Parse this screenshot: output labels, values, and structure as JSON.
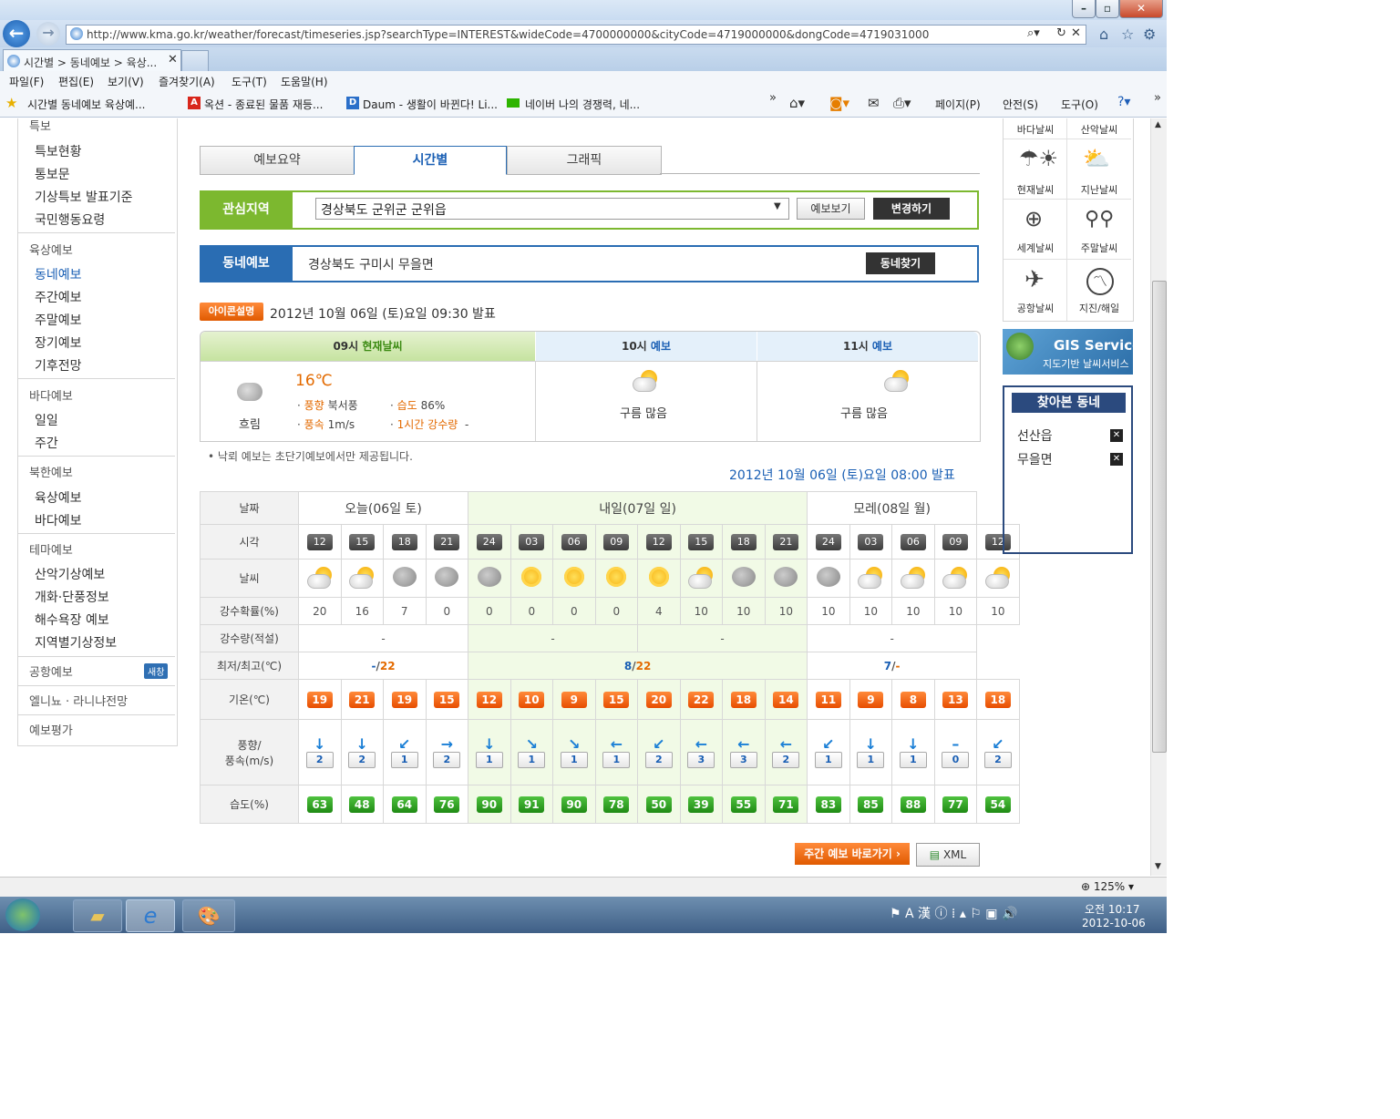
{
  "browser": {
    "url": "http://www.kma.go.kr/weather/forecast/timeseries.jsp?searchType=INTEREST&wideCode=4700000000&cityCode=4719000000&dongCode=4719031000",
    "tab_title": "시간별 > 동네예보 > 육상...",
    "menu": [
      "파일(F)",
      "편집(E)",
      "보기(V)",
      "즐겨찾기(A)",
      "도구(T)",
      "도움말(H)"
    ],
    "favorites": [
      "시간별 동네예보 육상예...",
      "옥션 - 종료된 물품 재등...",
      "Daum - 생활이 바뀐다! Li...",
      "네이버 나의 경쟁력, 네..."
    ],
    "cmd": [
      "페이지(P)",
      "안전(S)",
      "도구(O)"
    ],
    "zoom": "125%"
  },
  "taskbar": {
    "time": "오전 10:17",
    "date": "2012-10-06"
  },
  "left_nav": {
    "top_partial": "특보",
    "group1": [
      "특보현황",
      "통보문",
      "기상특보 발표기준",
      "국민행동요령"
    ],
    "sec_land": "육상예보",
    "group2": [
      "동네예보",
      "주간예보",
      "주말예보",
      "장기예보",
      "기후전망"
    ],
    "sec_sea": "바다예보",
    "group3": [
      "일일",
      "주간"
    ],
    "sec_nk": "북한예보",
    "group4": [
      "육상예보",
      "바다예보"
    ],
    "sec_theme": "테마예보",
    "group5": [
      "산악기상예보",
      "개화·단풍정보",
      "해수욕장 예보",
      "지역별기상정보"
    ],
    "sec_airport": "공항예보",
    "new_window": "새창",
    "sec_elnino": "엘니뇨 · 라니냐전망",
    "sec_eval": "예보평가"
  },
  "tabs": [
    "예보요약",
    "시간별",
    "그래픽"
  ],
  "interest": {
    "label": "관심지역",
    "selected": "경상북도 군위군 군위읍",
    "view_btn": "예보보기",
    "change_btn": "변경하기"
  },
  "dong": {
    "label": "동네예보",
    "location": "경상북도 구미시 무을면",
    "find_btn": "동네찾기"
  },
  "icon_btn": "아이콘설명",
  "issued1": "2012년 10월 06일 (토)요일 09:30 발표",
  "now": {
    "h1": "09시",
    "h1b": "현재날씨",
    "h2": "10시",
    "h2b": "예보",
    "h3": "11시",
    "h3b": "예보",
    "temp": "16℃",
    "cond": "흐림",
    "wind_dir_label": "풍향",
    "wind_dir": "북서풍",
    "hum_label": "습도",
    "hum": "86%",
    "wind_speed_label": "풍속",
    "wind_speed": "1m/s",
    "rain_label": "1시간 강수량",
    "rain": "-",
    "h2_cond": "구름 많음",
    "h3_cond": "구름 많음"
  },
  "note": "낙뢰 예보는 초단기예보에서만 제공됩니다.",
  "issued2": "2012년 10월 06일 (토)요일 08:00 발표",
  "table": {
    "row_labels": [
      "날짜",
      "시각",
      "날씨",
      "강수확률(%)",
      "강수량(적설)",
      "최저/최고(℃)",
      "기온(℃)",
      "풍향/",
      "풍속(m/s)",
      "습도(%)"
    ],
    "days": [
      "오늘(06일 토)",
      "내일(07일 일)",
      "모레(08일 월)"
    ],
    "hours": [
      "12",
      "15",
      "18",
      "21",
      "24",
      "03",
      "06",
      "09",
      "12",
      "15",
      "18",
      "21",
      "24",
      "03",
      "06",
      "09",
      "12"
    ],
    "weather": [
      "pcloud",
      "pcloud",
      "darkc",
      "darkc",
      "darkc",
      "sun",
      "sun",
      "sun",
      "sun",
      "pcloud",
      "darkc",
      "darkc",
      "darkc",
      "pcloud",
      "pcloud",
      "pcloud",
      "pcloud"
    ],
    "pop": [
      "20",
      "16",
      "7",
      "0",
      "0",
      "0",
      "0",
      "0",
      "4",
      "10",
      "10",
      "10",
      "10",
      "10",
      "10",
      "10",
      "10"
    ],
    "rain": [
      "-",
      "-",
      "-",
      "-"
    ],
    "minmax": [
      {
        "min": "-",
        "max": "22"
      },
      {
        "min": "8",
        "max": "22"
      },
      {
        "min": "7",
        "max": "-"
      }
    ],
    "temp": [
      "19",
      "21",
      "19",
      "15",
      "12",
      "10",
      "9",
      "15",
      "20",
      "22",
      "18",
      "14",
      "11",
      "9",
      "8",
      "13",
      "18"
    ],
    "wind_arrow": [
      "↓",
      "↓",
      "↙",
      "→",
      "↓",
      "↘",
      "↘",
      "←",
      "↙",
      "←",
      "←",
      "←",
      "↙",
      "↓",
      "↓",
      "–",
      "↙"
    ],
    "wind_speed": [
      "2",
      "2",
      "1",
      "2",
      "1",
      "1",
      "1",
      "1",
      "2",
      "3",
      "3",
      "2",
      "1",
      "1",
      "1",
      "0",
      "2"
    ],
    "humidity": [
      "63",
      "48",
      "64",
      "76",
      "90",
      "91",
      "90",
      "78",
      "50",
      "39",
      "55",
      "71",
      "83",
      "85",
      "88",
      "77",
      "54"
    ]
  },
  "weekly_btn": "주간 예보 바로가기 ›",
  "xml_btn": "XML",
  "right": {
    "tiles": [
      "바다날씨",
      "산악날씨",
      "현재날씨",
      "지난날씨",
      "세계날씨",
      "주말날씨",
      "공항날씨",
      "지진/해일"
    ],
    "gis_title": "GIS Service",
    "gis_sub": "지도기반 날씨서비스",
    "visited_title": "찾아본 동네",
    "visited": [
      "선산읍",
      "무을면"
    ]
  },
  "colors": {
    "accent_green": "#7cb82f",
    "accent_blue": "#2a6db3",
    "temp_orange": "#f06a1a",
    "hum_green": "#2b9a1e"
  }
}
